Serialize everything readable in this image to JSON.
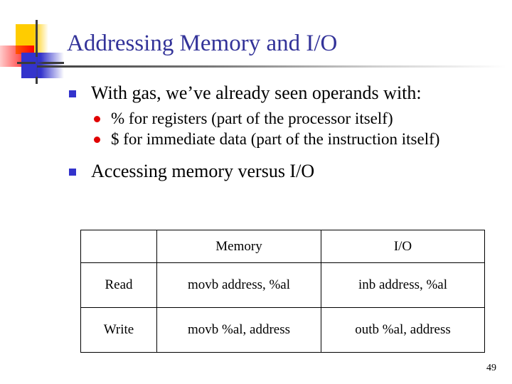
{
  "slide": {
    "title": "Addressing Memory and I/O",
    "page_number": "49",
    "title_color": "#333399",
    "bullet_square_color": "#3333CC",
    "bullet_dot_color": "#E00000",
    "decoration": {
      "yellow": "#FFCC00",
      "red": "#FF0000",
      "blue": "#3333CC",
      "line": "#3B3B3B"
    }
  },
  "bullets": [
    {
      "text": "With gas, we’ve already seen operands with:",
      "children": [
        "% for registers (part of the processor itself)",
        "$ for immediate data (part of the instruction itself)"
      ]
    },
    {
      "text": "Accessing memory versus I/O",
      "children": []
    }
  ],
  "table": {
    "headers": [
      "",
      "Memory",
      "I/O"
    ],
    "rows": [
      [
        "Read",
        "movb  address, %al",
        "inb  address, %al"
      ],
      [
        "Write",
        "movb  %al, address",
        "outb  %al, address"
      ]
    ]
  }
}
